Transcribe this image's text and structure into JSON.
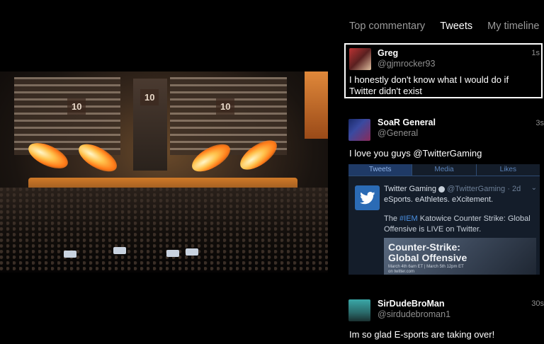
{
  "tabs": [
    {
      "label": "Top commentary",
      "active": false
    },
    {
      "label": "Tweets",
      "active": true
    },
    {
      "label": "My timeline",
      "active": false
    }
  ],
  "video": {
    "stage_signs": [
      "10",
      "10",
      "10"
    ]
  },
  "tweets": [
    {
      "name": "Greg",
      "handle": "@gjmrocker93",
      "time": "1s",
      "text": "I honestly don't know what I would do if Twitter didn't exist",
      "selected": true,
      "avatar_icon": "user-photo-icon"
    },
    {
      "name": "SoaR General",
      "handle": "@General",
      "time": "3s",
      "text": "I love you guys @TwitterGaming",
      "selected": false,
      "avatar_icon": "user-photo-icon"
    },
    {
      "name": "SirDudeBroMan",
      "handle": "@sirdudebroman1",
      "time": "30s",
      "text": "Im so glad E-sports are taking over!",
      "selected": false,
      "avatar_icon": "user-photo-icon"
    }
  ],
  "embed": {
    "tabs": [
      "Tweets",
      "Media",
      "Likes"
    ],
    "active_tab": "Tweets",
    "account_name": "Twitter Gaming",
    "account_handle": "@TwitterGaming · 2d",
    "line1": "eSports. eAthletes. eXcitement.",
    "body_pre": "The ",
    "body_hashtag": "#IEM",
    "body_post": " Katowice Counter Strike: Global Offensive is LIVE on Twitter.",
    "card_title_1": "Counter-Strike:",
    "card_title_2": "Global Offensive",
    "card_sub_1": "March 4th 6am ET | March 5th 12pm ET",
    "card_sub_2": "on twitter.com",
    "verified_icon": "verified-badge-icon",
    "logo_icon": "twitter-bird-icon"
  },
  "colors": {
    "background": "#000000",
    "tab_active": "#ffffff",
    "tab_inactive": "#9a9a9a",
    "handle": "#8f8f8f",
    "embed_bg": "#141d2a",
    "twitter_blue": "#2b6bb5",
    "hashtag": "#4a90e2"
  }
}
